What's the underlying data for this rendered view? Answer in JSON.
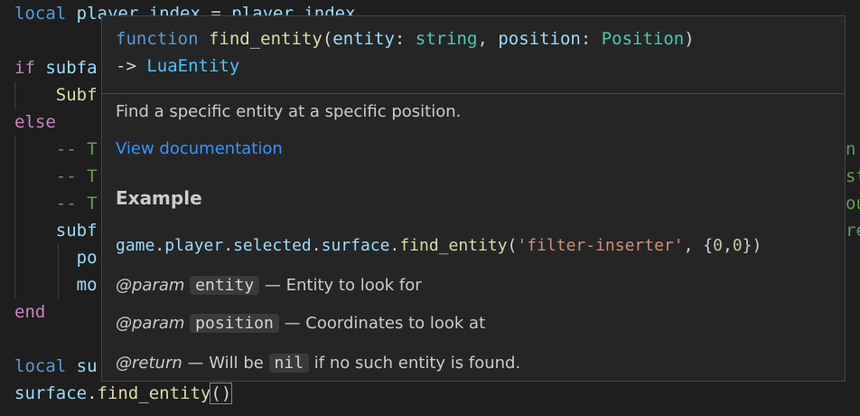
{
  "editor": {
    "lines": [
      {
        "id": "l1",
        "tokens": [
          [
            "kw",
            "local "
          ],
          [
            "var",
            "player_index"
          ],
          [
            "",
            "="
          ],
          [
            "var",
            " player_index"
          ]
        ]
      },
      {
        "id": "l3",
        "tokens": [
          [
            "kw2",
            "if "
          ],
          [
            "var",
            "subfa"
          ]
        ]
      },
      {
        "id": "l4",
        "tokens": [
          [
            "",
            "    "
          ],
          [
            "fn",
            "Subf"
          ]
        ]
      },
      {
        "id": "l5",
        "tokens": [
          [
            "kw2",
            "else"
          ]
        ]
      },
      {
        "id": "l6",
        "tokens": [
          [
            "",
            "    "
          ],
          [
            "cm",
            "-- T"
          ]
        ]
      },
      {
        "id": "l7",
        "tokens": [
          [
            "",
            "    "
          ],
          [
            "cm",
            "-- T"
          ]
        ]
      },
      {
        "id": "l8",
        "tokens": [
          [
            "",
            "    "
          ],
          [
            "cm",
            "-- T"
          ]
        ]
      },
      {
        "id": "l9",
        "tokens": [
          [
            "",
            "    "
          ],
          [
            "var",
            "subf"
          ]
        ]
      },
      {
        "id": "l10",
        "tokens": [
          [
            "",
            "      "
          ],
          [
            "var",
            "po"
          ]
        ]
      },
      {
        "id": "l11",
        "tokens": [
          [
            "",
            "      "
          ],
          [
            "var",
            "mo"
          ]
        ]
      },
      {
        "id": "l12",
        "tokens": [
          [
            "kw2",
            "end"
          ]
        ]
      },
      {
        "id": "l14",
        "tokens": [
          [
            "kw",
            "local "
          ],
          [
            "var",
            "su"
          ]
        ]
      },
      {
        "id": "l15",
        "tokens": [
          [
            "var",
            "surface"
          ],
          [
            "",
            "."
          ],
          [
            "fn",
            "find_entity"
          ],
          [
            "",
            "("
          ],
          [
            "",
            ")"
          ]
        ]
      }
    ],
    "right_fragments": [
      "n",
      "st",
      "ou",
      "re"
    ]
  },
  "hover": {
    "signature": {
      "keyword": "function",
      "name": "find_entity",
      "param1_name": "entity",
      "param1_type": "string",
      "param2_name": "position",
      "param2_type": "Position",
      "arrow": "->",
      "return_type": "LuaEntity"
    },
    "description": "Find a specific entity at a specific position.",
    "doc_link": "View documentation",
    "example_heading": "Example",
    "example_code": {
      "obj": "game",
      "p1": "player",
      "p2": "selected",
      "p3": "surface",
      "fn": "find_entity",
      "str": "'filter-inserter'",
      "n1": "0",
      "n2": "0"
    },
    "params": [
      {
        "tag": "@param",
        "name": "entity",
        "text": " — Entity to look for"
      },
      {
        "tag": "@param",
        "name": "position",
        "text": " — Coordinates to look at"
      }
    ],
    "return": {
      "tag": "@return",
      "pre": " — Will be ",
      "code": "nil",
      "post": " if no such entity is found."
    }
  }
}
